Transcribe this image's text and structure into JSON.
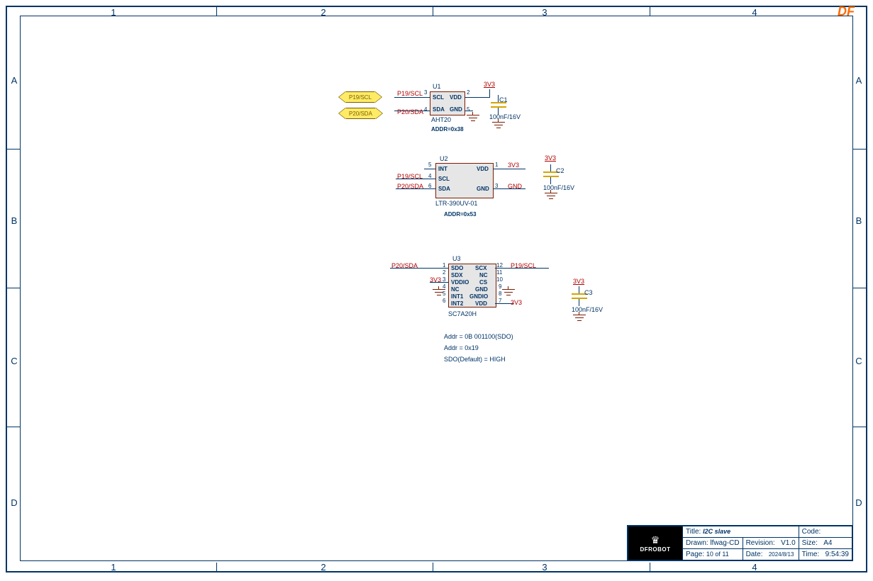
{
  "branding": {
    "top_logo": "DF",
    "tb_logo_icon": "♛",
    "tb_logo_text": "DFROBOT"
  },
  "ruler": {
    "cols": [
      "1",
      "2",
      "3",
      "4"
    ],
    "rows": [
      "A",
      "B",
      "C",
      "D"
    ]
  },
  "u1": {
    "ref": "U1",
    "part": "AHT20",
    "addr": "ADDR=0x38",
    "pins": {
      "scl": {
        "num": "3",
        "name": "SCL",
        "net": "P19/SCL"
      },
      "sda": {
        "num": "4",
        "name": "SDA",
        "net": "P20/SDA"
      },
      "vdd": {
        "num": "2",
        "name": "VDD"
      },
      "gnd": {
        "num": "5",
        "name": "GND"
      }
    },
    "nets": {
      "vdd": "3V3"
    },
    "cap": {
      "ref": "C1",
      "val": "100nF/16V",
      "rail": "3V3"
    }
  },
  "u2": {
    "ref": "U2",
    "part": "LTR-390UV-01",
    "addr": "ADDR=0x53",
    "pins": {
      "int": {
        "num": "5",
        "name": "INT"
      },
      "scl": {
        "num": "4",
        "name": "SCL",
        "net": "P19/SCL"
      },
      "sda": {
        "num": "6",
        "name": "SDA",
        "net": "P20/SDA"
      },
      "vdd": {
        "num": "1",
        "name": "VDD",
        "net": "3V3"
      },
      "gnd": {
        "num": "3",
        "name": "GND",
        "net": "GND"
      }
    },
    "cap": {
      "ref": "C2",
      "val": "100nF/16V",
      "rail": "3V3"
    }
  },
  "u3": {
    "ref": "U3",
    "part": "SC7A20H",
    "pins_left": [
      {
        "num": "1",
        "name": "SDO"
      },
      {
        "num": "2",
        "name": "SDX"
      },
      {
        "num": "3",
        "name": "VDDIO"
      },
      {
        "num": "4",
        "name": "NC"
      },
      {
        "num": "5",
        "name": "INT1"
      },
      {
        "num": "6",
        "name": "INT2"
      }
    ],
    "pins_right": [
      {
        "num": "12",
        "name": "SCX"
      },
      {
        "num": "11",
        "name": "NC"
      },
      {
        "num": "10",
        "name": "CS"
      },
      {
        "num": "9",
        "name": "GND"
      },
      {
        "num": "8",
        "name": "GNDIO"
      },
      {
        "num": "7",
        "name": "VDD"
      }
    ],
    "nets": {
      "sdo": "P20/SDA",
      "scx": "P19/SCL",
      "vddio": "3V3",
      "vdd": "3V3"
    },
    "cap": {
      "ref": "C3",
      "val": "100nF/16V",
      "rail": "3V3"
    },
    "notes": [
      "Addr = 0B 001100(SDO)",
      "Addr = 0x19",
      "SDO(Default) = HIGH"
    ]
  },
  "titleblock": {
    "title_k": "Title:",
    "title_v": "I2C slave",
    "drawn_k": "Drawn:",
    "drawn_v": "lfwag-CD",
    "rev_k": "Revision:",
    "rev_v": "V1.0",
    "page_k": "Page:",
    "page_v": "10  of   11",
    "date_k": "Date:",
    "date_v": "2024/8/13",
    "code_k": "Code:",
    "code_v": "",
    "size_k": "Size:",
    "size_v": "A4",
    "time_k": "Time:",
    "time_v": "9:54:39"
  }
}
